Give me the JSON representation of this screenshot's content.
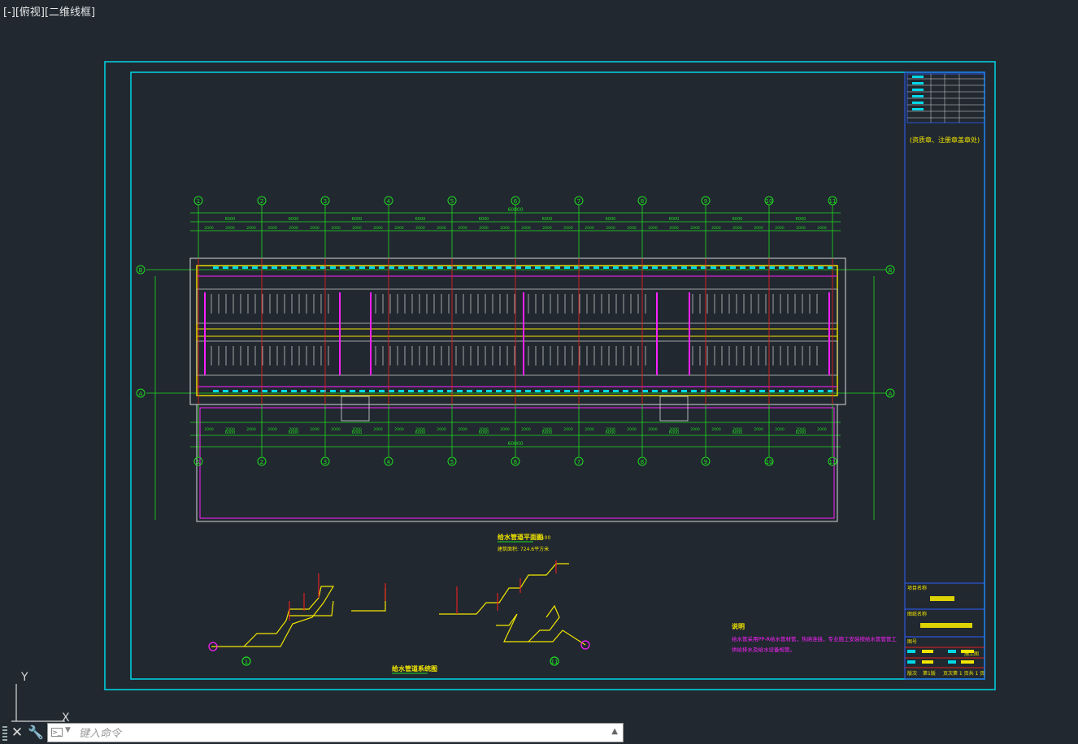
{
  "viewport": {
    "label": "[-][俯视][二维线框]"
  },
  "drawing": {
    "axis_numbers": [
      "1",
      "2",
      "3",
      "4",
      "5",
      "6",
      "7",
      "8",
      "9",
      "10",
      "11"
    ],
    "axis_letters": [
      "A",
      "B"
    ],
    "top_dims": [
      "6000",
      "6000",
      "6000",
      "6000",
      "6000",
      "6000",
      "6000",
      "6000",
      "6000",
      "6000"
    ],
    "sub_dims": [
      "2000",
      "2000",
      "2000"
    ],
    "overall_dim": "60000",
    "plan_title": "给水管道平面图",
    "plan_scale": "1:100",
    "plan_area": "建筑面积: 724.6平方米",
    "system_title": "给水管道系统图",
    "notes_title": "说明",
    "notes_lines": [
      "给水管采用PP-R给水管材管，热熔连接，专业施工安装按给水管管管工",
      "供给排水及给水设备规管。"
    ],
    "title_block": {
      "seal_text": "(资质章、注册章盖章处)",
      "project_label": "项目名称",
      "drawing_label": "图纸名称",
      "drawing_no_label": "图号",
      "stage": "施工图",
      "sheet_label": "版次",
      "sheet_value": "第1版",
      "page": "页次第 1 页共 1 页"
    },
    "system_labels": [
      "1",
      "11"
    ]
  },
  "command": {
    "placeholder": "键入命令",
    "close_icon": "close-icon",
    "customize_icon": "wrench-icon"
  },
  "colors": {
    "background": "#212830",
    "frame": "#00d8e8",
    "grid_green": "#1fdc1f",
    "axis_red": "#e02020",
    "pipe_yellow": "#f2e600",
    "magenta": "#ff20ff",
    "wall_white": "#d8d8d8"
  }
}
